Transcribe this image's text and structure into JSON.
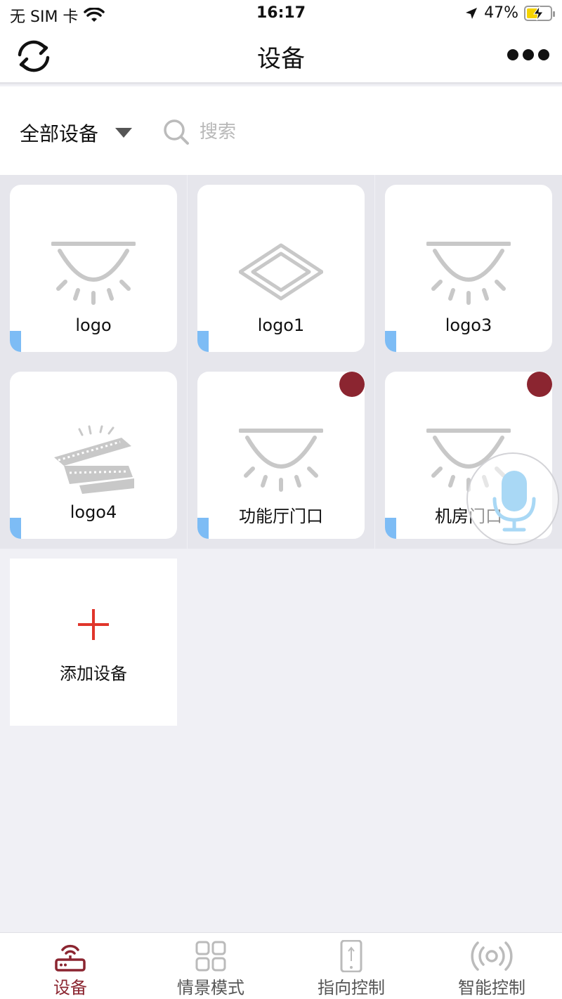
{
  "status_bar": {
    "carrier": "无 SIM 卡",
    "time": "16:17",
    "battery": "47%",
    "battery_level": 0.47
  },
  "nav": {
    "title": "设备"
  },
  "filter": {
    "dropdown_label": "全部设备",
    "search_placeholder": "搜索"
  },
  "devices": [
    {
      "label": "logo",
      "icon": "ceiling-light-icon",
      "badge": false
    },
    {
      "label": "logo1",
      "icon": "panel-light-icon",
      "badge": false
    },
    {
      "label": "logo3",
      "icon": "ceiling-light-icon",
      "badge": false
    },
    {
      "label": "logo4",
      "icon": "light-strip-icon",
      "badge": false
    },
    {
      "label": "功能厅门口",
      "icon": "ceiling-light-icon",
      "badge": true
    },
    {
      "label": "机房门口",
      "icon": "ceiling-light-icon",
      "badge": true
    }
  ],
  "add_device": {
    "label": "添加设备"
  },
  "tabs": [
    {
      "label": "设备",
      "icon": "router-icon",
      "active": true
    },
    {
      "label": "情景模式",
      "icon": "grid-icon",
      "active": false
    },
    {
      "label": "指向控制",
      "icon": "phone-point-icon",
      "active": false
    },
    {
      "label": "智能控制",
      "icon": "broadcast-icon",
      "active": false
    }
  ],
  "colors": {
    "accent": "#8b2530",
    "strip": "#7dbcf5",
    "icon_gray": "#c8c8c8",
    "add_plus": "#e0352b",
    "mic": "#a9d8f5"
  }
}
